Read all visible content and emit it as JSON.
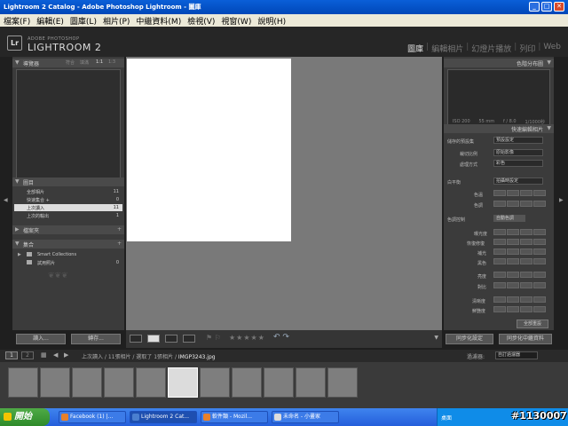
{
  "window": {
    "title": "Lightroom 2 Catalog - Adobe Photoshop Lightroom - 圖庫"
  },
  "menu": [
    "檔案(F)",
    "編輯(E)",
    "圖庫(L)",
    "相片(P)",
    "中繼資料(M)",
    "檢視(V)",
    "視窗(W)",
    "說明(H)"
  ],
  "brand": {
    "small": "ADOBE PHOTOSHOP",
    "big": "LIGHTROOM 2",
    "logo": "Lr"
  },
  "modules": [
    {
      "label": "圖庫",
      "active": true
    },
    {
      "label": "編輯相片",
      "active": false
    },
    {
      "label": "幻燈片播放",
      "active": false
    },
    {
      "label": "列印",
      "active": false
    },
    {
      "label": "Web",
      "active": false
    }
  ],
  "left": {
    "navigator": {
      "title": "導覽器",
      "zoom": [
        "符合",
        "填滿",
        "1:1",
        "1:3"
      ]
    },
    "catalog": {
      "title": "圖目",
      "items": [
        {
          "label": "全部相片",
          "count": "11",
          "selected": false
        },
        {
          "label": "快速集合 +",
          "count": "0",
          "selected": false
        },
        {
          "label": "上次讀入",
          "count": "11",
          "selected": true
        },
        {
          "label": "上次的輸出",
          "count": "1",
          "selected": false
        }
      ]
    },
    "folders": {
      "title": "檔案夾"
    },
    "collections": {
      "title": "集合",
      "items": [
        {
          "label": "Smart Collections",
          "count": ""
        },
        {
          "label": "試用照片",
          "count": "0"
        }
      ]
    },
    "import_button": "讀入...",
    "export_button": "轉存..."
  },
  "right": {
    "histogram": {
      "title": "色階分布圖",
      "info": [
        "ISO 200",
        "55 mm",
        "f / 8.0",
        "1/1000秒"
      ]
    },
    "quick_develop": {
      "title": "快速編輯相片",
      "saved_preset": {
        "label": "儲存的預設集",
        "value": "預設設定"
      },
      "crop_ratio": {
        "label": "裁切比例",
        "value": "原始影像"
      },
      "treatment": {
        "label": "處理方式",
        "value": "彩色"
      },
      "white_balance": {
        "label": "白平衡",
        "value": "拍攝時設定"
      },
      "wb_rows": [
        "色溫",
        "色調"
      ],
      "tone_control": {
        "label": "色調控制",
        "button": "自動色調"
      },
      "tone_rows": [
        "曝光度",
        "恢復修復",
        "補光",
        "黑色",
        "亮度",
        "對比"
      ],
      "presence_rows": [
        "清晰度",
        "鮮艷度"
      ],
      "reset_button": "全部重設"
    },
    "sync_settings": "同步化設定",
    "sync_metadata": "同步化中繼資料"
  },
  "filmstrip_nav": {
    "page1": "1",
    "page2": "2",
    "breadcrumb": "上次讀入 / 11張相片 / 選取了 1張相片 /",
    "filename": "IMGP3243.jpg",
    "filter_label": "過濾器:",
    "filter_value": "自訂過濾器"
  },
  "toolbar": {
    "stars": "★★★★★"
  },
  "taskbar": {
    "start": "開始",
    "tasks": [
      {
        "label": "Facebook (1) |...",
        "color": "#e8802a"
      },
      {
        "label": "Lightroom 2 Cat...",
        "color": "#4a7fd0"
      },
      {
        "label": "軟件類 - Mozil...",
        "color": "#e8802a"
      },
      {
        "label": "未命名 - 小畫家",
        "color": "#ddd"
      }
    ],
    "tray_label": "桌面",
    "watermark": "#1130007"
  }
}
